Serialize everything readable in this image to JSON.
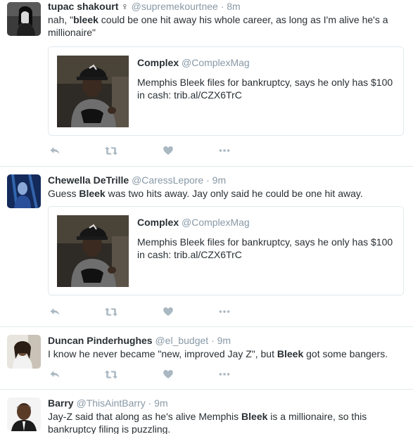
{
  "colors": {
    "icon": "#aab8c2",
    "muted": "#8899a6",
    "text": "#292f33",
    "border": "#e1e8ed"
  },
  "tweets": [
    {
      "name": "tupac shakourt",
      "name_symbol": "♀",
      "handle": "@supremekourtnee",
      "separator": "·",
      "time": "8m",
      "text_parts": [
        "nah, \"",
        "bleek",
        " could be one hit away his whole career, as long as I'm alive he's a millionaire\""
      ],
      "card": {
        "name": "Complex",
        "handle": "@ComplexMag",
        "text": "Memphis Bleek files for bankruptcy, says he only has $100 in cash: trib.al/CZX6TrC"
      }
    },
    {
      "name": "Chewella DeTrille",
      "handle": "@CaressLepore",
      "separator": "·",
      "time": "9m",
      "text_parts": [
        "Guess ",
        "Bleek",
        " was two hits away. Jay only said he could be one hit away."
      ],
      "card": {
        "name": "Complex",
        "handle": "@ComplexMag",
        "text": "Memphis Bleek files for bankruptcy, says he only has $100 in cash: trib.al/CZX6TrC"
      }
    },
    {
      "name": "Duncan Pinderhughes",
      "handle": "@el_budget",
      "separator": "·",
      "time": "9m",
      "text_parts": [
        "I know he never became \"new, improved Jay Z\", but ",
        "Bleek",
        " got some bangers."
      ]
    },
    {
      "name": "Barry",
      "handle": "@ThisAintBarry",
      "separator": "·",
      "time": "9m",
      "text_parts": [
        "Jay-Z said that along as he's alive Memphis ",
        "Bleek",
        " is a millionaire, so this bankruptcy filing is puzzling."
      ]
    }
  ],
  "icons": {
    "reply": "reply-icon",
    "retweet": "retweet-icon",
    "like": "heart-icon",
    "more": "more-icon"
  }
}
